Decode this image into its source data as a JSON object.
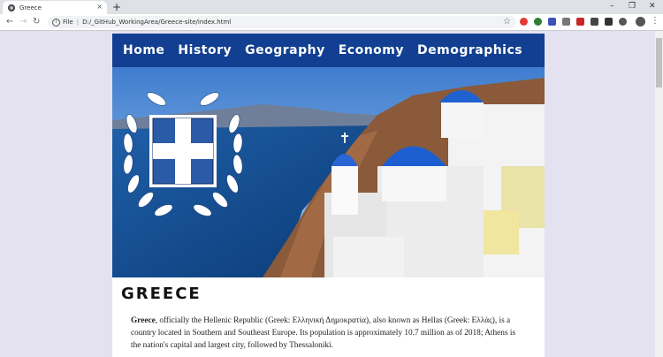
{
  "browser": {
    "tab_title": "Greece",
    "new_tab": "+",
    "close_tab": "×",
    "url_scheme": "File",
    "url_path": "D:/_GitHub_WorkingArea/Greece-site/index.html",
    "window_controls": {
      "minimize": "–",
      "restore": "❐",
      "close": "✕"
    },
    "nav_glyphs": {
      "back": "←",
      "forward": "→",
      "reload": "↻"
    }
  },
  "nav": {
    "items": [
      "Home",
      "History",
      "Geography",
      "Economy",
      "Demographics"
    ]
  },
  "main": {
    "title": "GREECE",
    "intro_bold": "Greece",
    "intro_text": ", officially the Hellenic Republic (Greek: Ελληνική Δημοκρατία), also known as Hellas (Greek: Ελλάς), is a country located in Southern and Southeast Europe. Its population is approximately 10.7 million as of 2018; Athens is the nation's capital and largest city, followed by Thessaloniki."
  },
  "colors": {
    "nav_bg": "#123f91",
    "page_bg": "#e4e1f0",
    "flag_blue": "#2b5aa6"
  },
  "icons": [
    "favicon-icon",
    "back-icon",
    "forward-icon",
    "reload-icon",
    "info-icon",
    "star-icon",
    "profile-icon",
    "menu-icon",
    "coat-of-arms-icon"
  ]
}
